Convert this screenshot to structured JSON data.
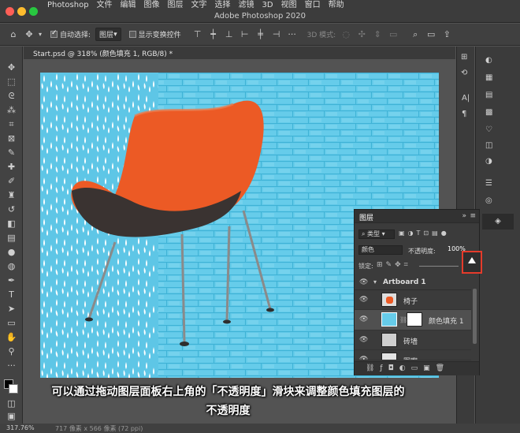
{
  "menubar": {
    "items": [
      "Photoshop",
      "文件",
      "编辑",
      "图像",
      "图层",
      "文字",
      "选择",
      "滤镜",
      "3D",
      "视图",
      "窗口",
      "帮助"
    ]
  },
  "window": {
    "title": "Adobe Photoshop 2020"
  },
  "options_bar": {
    "auto_select_label": "自动选择:",
    "auto_select_value": "图层",
    "show_transform_label": "显示变换控件",
    "mode_3d_label": "3D 模式:"
  },
  "document": {
    "tab_label": "Start.psd @ 318% (颜色填充 1, RGB/8) *"
  },
  "layers_panel": {
    "title": "图层",
    "filter_label": "类型",
    "blend_mode": "颜色",
    "opacity_label": "不透明度:",
    "opacity_value": "100%",
    "lock_label": "锁定:",
    "artboard_name": "Artboard 1",
    "layers": [
      {
        "name": "椅子",
        "thumb": "chair"
      },
      {
        "name": "颜色填充 1",
        "thumb": "fill"
      },
      {
        "name": "砖墙",
        "thumb": "brick"
      },
      {
        "name": "图案",
        "thumb": "pattern"
      }
    ]
  },
  "colors": {
    "fill_color": "#66ccea",
    "chair_orange": "#ec5a25",
    "highlight_red": "#e53b2b"
  },
  "status": {
    "zoom": "317.76%",
    "doc_info": "717 像素 x 566 像素 (72 ppi)"
  },
  "caption": {
    "line1": "可以通过拖动图层面板右上角的「不透明度」滑块来调整颜色填充图层的",
    "line2": "不透明度"
  }
}
